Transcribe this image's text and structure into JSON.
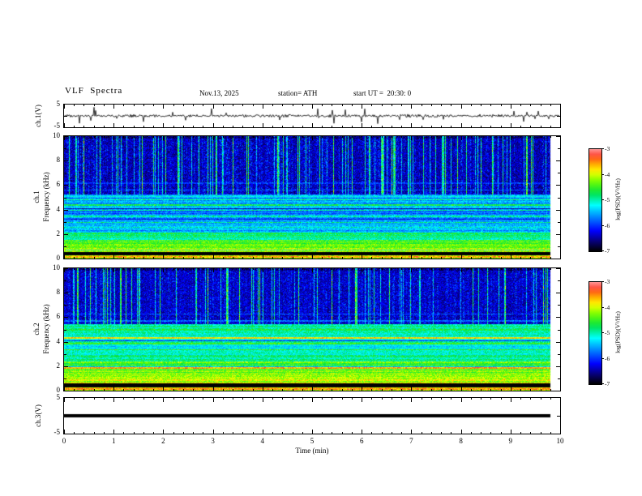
{
  "header": {
    "title": "VLF  Spectra",
    "date": "Nov.13, 2025",
    "station": "station= ATH",
    "start_ut": "start UT =  20:30: 0"
  },
  "labels": {
    "ch1_wave": "ch.1(V)",
    "ch1_row": "ch.1",
    "ch2_row": "ch.2",
    "freq": "Frequency (kHz)",
    "ch3_wave": "ch.3(V)",
    "time": "Time (min)"
  },
  "axes": {
    "x": {
      "label": "Time (min)",
      "ticks": [
        0,
        1,
        2,
        3,
        4,
        5,
        6,
        7,
        8,
        9,
        10
      ]
    },
    "freq_ticks": [
      10,
      8,
      6,
      4,
      2,
      0
    ],
    "volt_ticks": [
      5,
      -5
    ],
    "colorbar_ticks": [
      -3,
      -4,
      -5,
      -6,
      -7
    ]
  },
  "chart_data": [
    {
      "id": "ch1-waveform",
      "type": "line",
      "ylabel": "ch.1(V)",
      "xlim": [
        0,
        10
      ],
      "ylim": [
        -5,
        5
      ],
      "baseline_v": 0,
      "noise_amplitude_v": 0.7,
      "spike_amplitude_v": 3.5,
      "spike_probability": 0.03,
      "description": "Broadband noisy waveform centered on 0 V with impulsive sferic spikes up to about ±4 V across the full 10 minutes"
    },
    {
      "id": "ch1-spectrogram",
      "type": "heatmap",
      "row_label": "ch.1",
      "ylabel": "Frequency (kHz)",
      "xlim": [
        0,
        10
      ],
      "ylim": [
        0,
        10
      ],
      "zlim": [
        -7,
        -3
      ],
      "colorbar_label": "log(PSD)(V²/Hz)",
      "colorbar_ticks": [
        -3,
        -4,
        -5,
        -6,
        -7
      ],
      "data_end_min": 9.82,
      "bands": [
        {
          "f": [
            0.0,
            0.25
          ],
          "level": -4.2
        },
        {
          "f": [
            0.25,
            0.55
          ],
          "level": -7.0
        },
        {
          "f": [
            0.55,
            0.95
          ],
          "level": -4.15
        },
        {
          "f": [
            0.95,
            1.6
          ],
          "level": -4.45
        },
        {
          "f": [
            1.6,
            2.2
          ],
          "level": -4.9
        },
        {
          "f": [
            2.2,
            3.2
          ],
          "level": -5.5
        },
        {
          "f": [
            3.2,
            4.1
          ],
          "level": -5.7
        },
        {
          "f": [
            4.1,
            5.2
          ],
          "level": -5.4
        },
        {
          "f": [
            5.2,
            10.0
          ],
          "level": -6.45
        }
      ],
      "lines": [
        {
          "f": 0.12,
          "level": -3.6
        },
        {
          "f": 2.05,
          "level": -4.7
        },
        {
          "f": 2.55,
          "level": -5.0
        },
        {
          "f": 2.95,
          "level": -4.9
        },
        {
          "f": 3.45,
          "level": -5.0
        },
        {
          "f": 3.95,
          "level": -4.9
        },
        {
          "f": 4.35,
          "level": -4.7
        },
        {
          "f": 4.8,
          "level": -4.9
        },
        {
          "f": 5.6,
          "level": -5.9
        },
        {
          "f": 6.15,
          "level": -6.0
        }
      ],
      "sferics": {
        "strong_fraction": 0.16,
        "strong_level": -4.5,
        "weak_level": -6.1,
        "f_min": 4.8
      },
      "description": "Dense vertical sferic streaks (blue/cyan/green) above ~5 kHz over a dark-blue background; banded green/yellow emissions below 5 kHz; solid black band near 0.3-0.5 kHz"
    },
    {
      "id": "ch2-spectrogram",
      "type": "heatmap",
      "row_label": "ch.2",
      "ylabel": "Frequency (kHz)",
      "xlim": [
        0,
        10
      ],
      "ylim": [
        0,
        10
      ],
      "zlim": [
        -7,
        -3
      ],
      "colorbar_label": "log(PSD)(V²/Hz)",
      "colorbar_ticks": [
        -3,
        -4,
        -5,
        -6,
        -7
      ],
      "data_end_min": 9.82,
      "bands": [
        {
          "f": [
            0.0,
            0.25
          ],
          "level": -4.0
        },
        {
          "f": [
            0.25,
            0.6
          ],
          "level": -7.0
        },
        {
          "f": [
            0.6,
            1.0
          ],
          "level": -4.0
        },
        {
          "f": [
            1.0,
            1.7
          ],
          "level": -4.3
        },
        {
          "f": [
            1.7,
            2.4
          ],
          "level": -4.6
        },
        {
          "f": [
            2.4,
            3.3
          ],
          "level": -5.0
        },
        {
          "f": [
            3.3,
            4.3
          ],
          "level": -5.1
        },
        {
          "f": [
            4.3,
            5.4
          ],
          "level": -5.0
        },
        {
          "f": [
            5.4,
            10.0
          ],
          "level": -6.4
        }
      ],
      "lines": [
        {
          "f": 0.12,
          "level": -3.5
        },
        {
          "f": 0.85,
          "level": -3.9
        },
        {
          "f": 1.85,
          "level": -3.6
        },
        {
          "f": 2.3,
          "level": -4.3
        },
        {
          "f": 2.8,
          "level": -4.8
        },
        {
          "f": 3.35,
          "level": -4.5
        },
        {
          "f": 3.85,
          "level": -4.5
        },
        {
          "f": 4.3,
          "level": -3.8
        },
        {
          "f": 4.95,
          "level": -4.7
        },
        {
          "f": 5.7,
          "level": -5.8
        },
        {
          "f": 6.25,
          "level": -5.9
        }
      ],
      "sferics": {
        "strong_fraction": 0.14,
        "strong_level": -4.5,
        "weak_level": -6.1,
        "f_min": 5.0
      },
      "description": "Similar to ch.1 but with stronger green/yellow banded emissions below 5 kHz and a few reddish horizontal lines near 1.9 and 4.3 kHz"
    },
    {
      "id": "ch3-waveform",
      "type": "line",
      "ylabel": "ch.3(V)",
      "xlim": [
        0,
        10
      ],
      "ylim": [
        -5,
        5
      ],
      "constant_value_v": 0,
      "data_end_min": 9.82,
      "description": "Flat heavy black trace at 0 V for the whole interval"
    }
  ]
}
